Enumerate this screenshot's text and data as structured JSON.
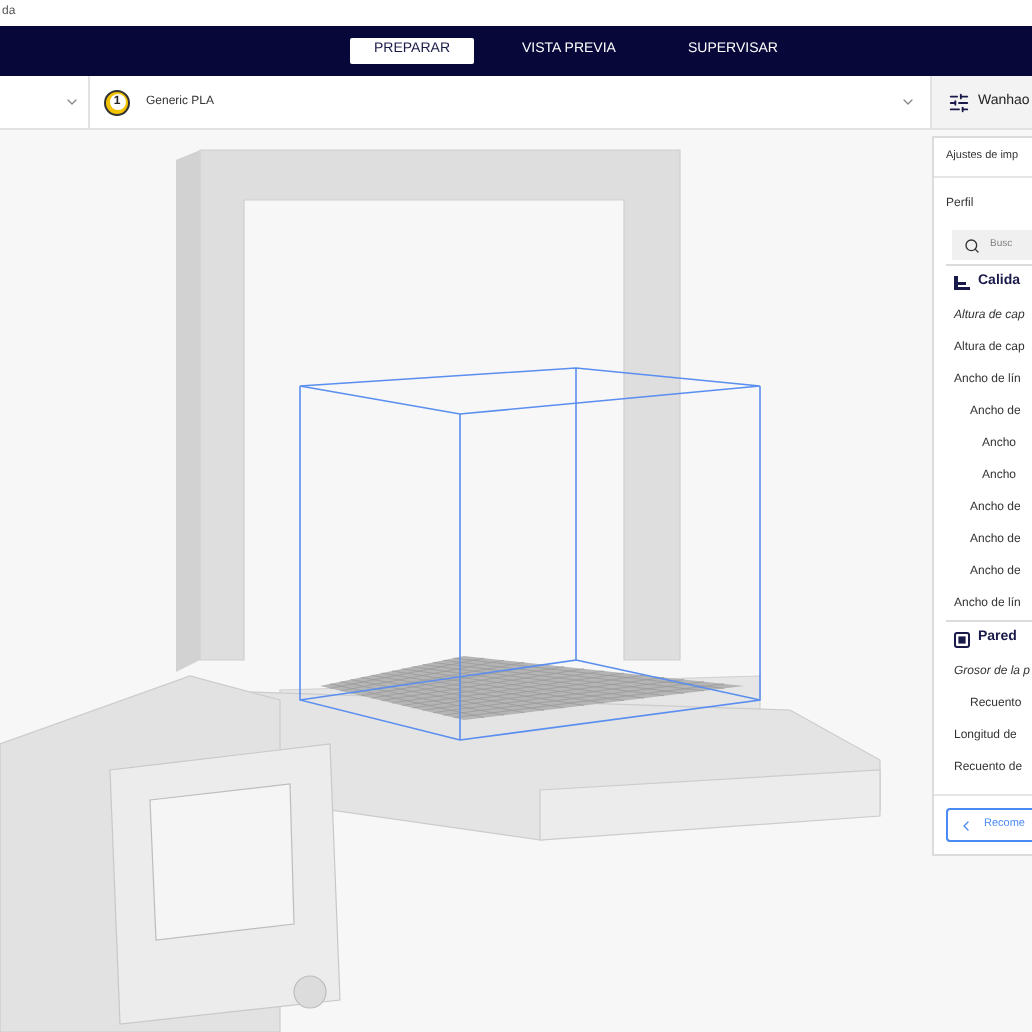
{
  "window": {
    "title": "da"
  },
  "tabs": [
    {
      "label": "PREPARAR",
      "selected": true
    },
    {
      "label": "VISTA PREVIA",
      "selected": false
    },
    {
      "label": "SUPERVISAR",
      "selected": false
    }
  ],
  "extruder": {
    "number": "1",
    "material": "Generic PLA"
  },
  "settings_button": {
    "label": "Wanhao"
  },
  "print_settings": {
    "title": "Ajustes de imp",
    "profile_label": "Perfil",
    "search": {
      "placeholder": "Busc"
    },
    "sections": [
      {
        "title": "Calida",
        "settings": [
          {
            "label": "Altura de cap",
            "modified": true
          },
          {
            "label": "Altura de cap",
            "modified": false
          },
          {
            "label": "Ancho de lín",
            "modified": false,
            "children": [
              {
                "label": "Ancho de",
                "modified": false,
                "children": [
                  {
                    "label": "Ancho",
                    "modified": false
                  },
                  {
                    "label": "Ancho",
                    "modified": false
                  }
                ]
              },
              {
                "label": "Ancho de",
                "modified": false
              },
              {
                "label": "Ancho de",
                "modified": false
              },
              {
                "label": "Ancho de",
                "modified": false
              }
            ]
          },
          {
            "label": "Ancho de lín",
            "modified": false
          }
        ]
      },
      {
        "title": "Pared",
        "settings": [
          {
            "label": "Grosor de la p",
            "modified": true,
            "children": [
              {
                "label": "Recuento",
                "modified": false
              }
            ]
          },
          {
            "label": "Longitud de",
            "modified": false
          },
          {
            "label": "Recuento de",
            "modified": false
          }
        ]
      }
    ],
    "recommended_button": "Recome"
  }
}
